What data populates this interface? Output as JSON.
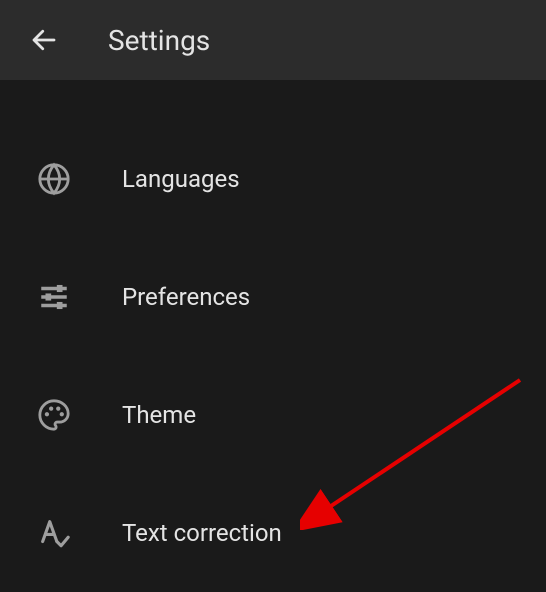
{
  "header": {
    "title": "Settings"
  },
  "menu": {
    "items": [
      {
        "label": "Languages",
        "icon": "globe-icon"
      },
      {
        "label": "Preferences",
        "icon": "sliders-icon"
      },
      {
        "label": "Theme",
        "icon": "palette-icon"
      },
      {
        "label": "Text correction",
        "icon": "text-check-icon"
      }
    ]
  }
}
